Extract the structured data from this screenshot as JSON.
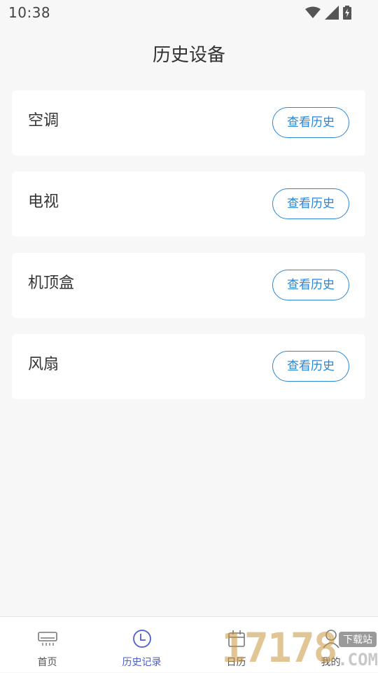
{
  "status_bar": {
    "time": "10:38",
    "icons": [
      "wifi-icon",
      "signal-icon",
      "battery-charging-icon"
    ]
  },
  "header": {
    "title": "历史设备"
  },
  "devices": [
    {
      "name": "空调",
      "button_label": "查看历史"
    },
    {
      "name": "电视",
      "button_label": "查看历史"
    },
    {
      "name": "机顶盒",
      "button_label": "查看历史"
    },
    {
      "name": "风扇",
      "button_label": "查看历史"
    }
  ],
  "bottom_nav": {
    "active": "历史记录",
    "items": [
      {
        "label": "首页",
        "icon": "air-conditioner-icon"
      },
      {
        "label": "历史记录",
        "icon": "clock-icon"
      },
      {
        "label": "日历",
        "icon": "calendar-icon"
      },
      {
        "label": "我的",
        "icon": "user-icon"
      }
    ]
  },
  "watermark": {
    "digits": "17178",
    "suffix": ".COM",
    "tag": "下载站"
  },
  "colors": {
    "accent_blue": "#2b86d6",
    "nav_active": "#4a5fd0",
    "background": "#f7f7f7"
  }
}
